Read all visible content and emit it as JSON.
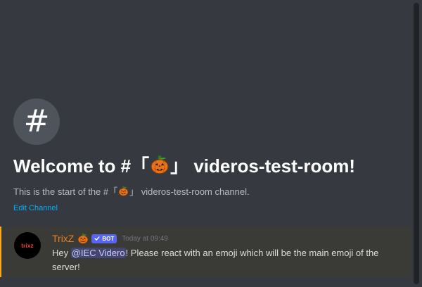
{
  "channel": {
    "hash_glyph": "#",
    "welcome_prefix": "Welcome to #「",
    "welcome_suffix": "」 videros-test-room!",
    "desc_prefix": "This is the start of the #「",
    "desc_suffix": "」 videros-test-room channel.",
    "channel_emoji": "jack-o-lantern-icon",
    "edit_label": "Edit Channel"
  },
  "message": {
    "username": "TrixZ",
    "user_emoji": "jack-o-lantern-icon",
    "bot_tag": "BOT",
    "timestamp": "Today at 09:49",
    "avatar_text": "trixz",
    "content_prefix": "Hey ",
    "mention": "@IEC Videro",
    "content_suffix": "! Please react with an emoji which will be the main emoji of the server!"
  },
  "colors": {
    "background": "#36393f",
    "username": "#e67e22",
    "bot_tag": "#5865f2",
    "link": "#00b0f4",
    "highlight_border": "#faa81a"
  }
}
